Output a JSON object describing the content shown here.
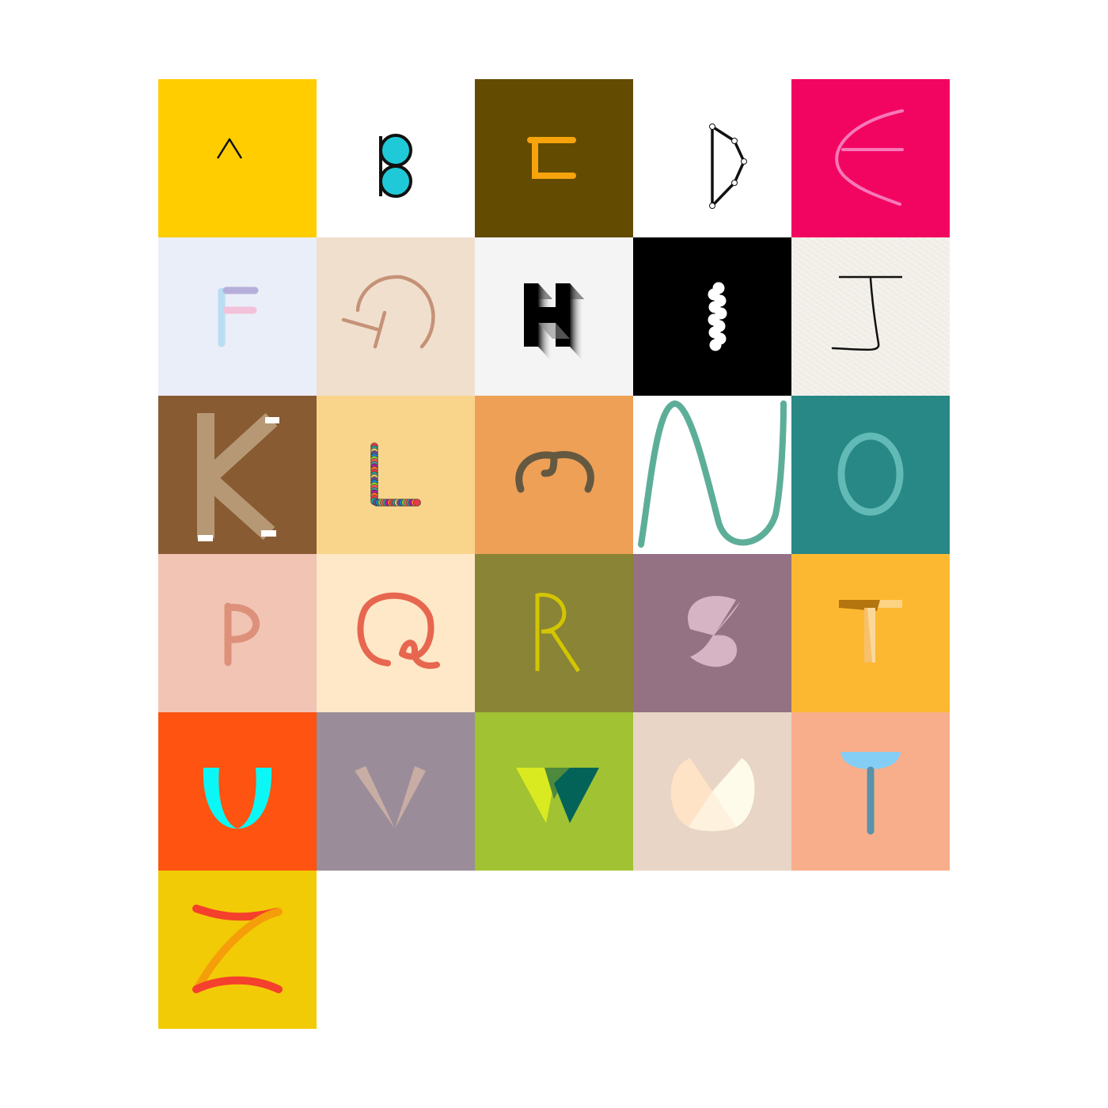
{
  "tiles": [
    {
      "letter": "A",
      "icon": "letter-a-thin-caret-icon",
      "background": "#FFCD00"
    },
    {
      "letter": "B",
      "icon": "letter-b-stacked-circles-icon",
      "background": "#FFFFFF"
    },
    {
      "letter": "C",
      "icon": "letter-c-bracket-icon",
      "background": "#634B02"
    },
    {
      "letter": "D",
      "icon": "letter-d-node-polyline-icon",
      "background": "#FFFFFF"
    },
    {
      "letter": "E",
      "icon": "letter-e-curved-line-icon",
      "background": "#F20560"
    },
    {
      "letter": "F",
      "icon": "letter-f-pastel-strokes-icon",
      "background": "#EAEEF8"
    },
    {
      "letter": "G",
      "icon": "letter-g-arc-icon",
      "background": "#F0DFCD"
    },
    {
      "letter": "H",
      "icon": "letter-h-extruded-gradient-icon",
      "background": "#F4F4F4"
    },
    {
      "letter": "I",
      "icon": "letter-i-wavy-dots-icon",
      "background": "#000000"
    },
    {
      "letter": "J",
      "icon": "letter-j-handdrawn-icon",
      "background": "#F3F0EA"
    },
    {
      "letter": "K",
      "icon": "letter-k-wide-strokes-icon",
      "background": "#885B32"
    },
    {
      "letter": "L",
      "icon": "letter-l-confetti-dots-icon",
      "background": "#F9D58C"
    },
    {
      "letter": "M",
      "icon": "letter-m-rotated-three-icon",
      "background": "#EEA057"
    },
    {
      "letter": "N",
      "icon": "letter-n-wave-line-icon",
      "background": "#FFFFFF"
    },
    {
      "letter": "O",
      "icon": "letter-o-ring-icon",
      "background": "#278885"
    },
    {
      "letter": "P",
      "icon": "letter-p-rounded-stroke-icon",
      "background": "#F1C4B4"
    },
    {
      "letter": "Q",
      "icon": "letter-q-loop-tail-icon",
      "background": "#FEE8C7"
    },
    {
      "letter": "R",
      "icon": "letter-r-thin-stroke-icon",
      "background": "#898436"
    },
    {
      "letter": "S",
      "icon": "letter-s-split-circle-icon",
      "background": "#957184"
    },
    {
      "letter": "T",
      "icon": "letter-t-shaded-bars-icon",
      "background": "#FDB832"
    },
    {
      "letter": "U",
      "icon": "letter-u-crescent-icon",
      "background": "#FE5311"
    },
    {
      "letter": "V",
      "icon": "letter-v-tapered-wedges-icon",
      "background": "#9B8C9A"
    },
    {
      "letter": "W",
      "icon": "letter-w-overlapping-triangles-icon",
      "background": "#A1C232"
    },
    {
      "letter": "X",
      "icon": "letter-x-pie-cutout-icon",
      "background": "#E8D5C6"
    },
    {
      "letter": "Y",
      "icon": "letter-y-bowl-stem-icon",
      "background": "#F8AE8A"
    },
    {
      "letter": "Z",
      "icon": "letter-z-ribbon-strokes-icon",
      "background": "#F2CB07"
    }
  ]
}
